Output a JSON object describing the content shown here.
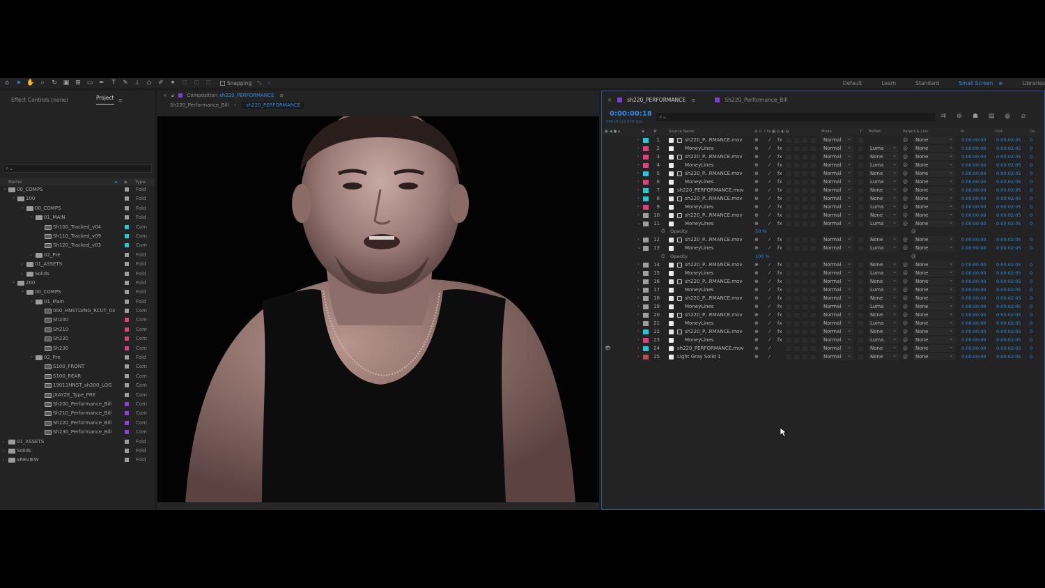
{
  "toolbar": {
    "snapping_label": "Snapping",
    "workspaces": [
      "Default",
      "Learn",
      "Standard",
      "Small Screen",
      "Libraries"
    ],
    "active_workspace": "Small Screen"
  },
  "project_panel": {
    "tabs": [
      "Effect Controls (none)",
      "Project"
    ],
    "search_placeholder": "⌕⌄",
    "columns": {
      "name": "Name",
      "type": "Type"
    },
    "items": [
      {
        "depth": 0,
        "kind": "folder",
        "open": true,
        "name": "00_COMPS",
        "label": "#9e9e9e",
        "type": "Fold"
      },
      {
        "depth": 1,
        "kind": "folder",
        "open": true,
        "name": "100",
        "label": "#9e9e9e",
        "type": "Fold"
      },
      {
        "depth": 2,
        "kind": "folder",
        "open": true,
        "name": "00_COMPS",
        "label": "#9e9e9e",
        "type": "Fold"
      },
      {
        "depth": 3,
        "kind": "folder",
        "open": true,
        "name": "01_MAIN",
        "label": "#9e9e9e",
        "type": "Fold"
      },
      {
        "depth": 4,
        "kind": "comp",
        "name": "Sh100_Tracked_v04",
        "label": "#1ec9d9",
        "type": "Com"
      },
      {
        "depth": 4,
        "kind": "comp",
        "name": "Sh110_Tracked_v09",
        "label": "#1ec9d9",
        "type": "Com"
      },
      {
        "depth": 4,
        "kind": "comp",
        "name": "Sh120_Tracked_v03",
        "label": "#1ec9d9",
        "type": "Com"
      },
      {
        "depth": 3,
        "kind": "folder",
        "open": false,
        "name": "02_Pre",
        "label": "#9e9e9e",
        "type": "Fold"
      },
      {
        "depth": 2,
        "kind": "folder",
        "open": false,
        "name": "01_ASSETS",
        "label": "#9e9e9e",
        "type": "Fold"
      },
      {
        "depth": 2,
        "kind": "folder",
        "open": false,
        "name": "Solids",
        "label": "#9e9e9e",
        "type": "Fold"
      },
      {
        "depth": 1,
        "kind": "folder",
        "open": true,
        "name": "200",
        "label": "#9e9e9e",
        "type": "Fold"
      },
      {
        "depth": 2,
        "kind": "folder",
        "open": true,
        "name": "00_COMPS",
        "label": "#9e9e9e",
        "type": "Fold"
      },
      {
        "depth": 3,
        "kind": "folder",
        "open": true,
        "name": "01_Main",
        "label": "#9e9e9e",
        "type": "Fold"
      },
      {
        "depth": 4,
        "kind": "comp",
        "name": "000_HNSTLVNG_RCUT_03",
        "label": "#9e9e9e",
        "type": "Com"
      },
      {
        "depth": 4,
        "kind": "comp",
        "name": "Sh200",
        "label": "#e0407e",
        "type": "Com"
      },
      {
        "depth": 4,
        "kind": "comp",
        "name": "Sh210",
        "label": "#e0407e",
        "type": "Com"
      },
      {
        "depth": 4,
        "kind": "comp",
        "name": "Sh220",
        "label": "#e0407e",
        "type": "Com"
      },
      {
        "depth": 4,
        "kind": "comp",
        "name": "Sh230",
        "label": "#e0407e",
        "type": "Com"
      },
      {
        "depth": 3,
        "kind": "folder",
        "open": true,
        "name": "02_Pre",
        "label": "#9e9e9e",
        "type": "Fold"
      },
      {
        "depth": 4,
        "kind": "comp",
        "name": "S100_FRONT",
        "label": "#9e9e9e",
        "type": "Com"
      },
      {
        "depth": 4,
        "kind": "comp",
        "name": "S100_REAR",
        "label": "#9e9e9e",
        "type": "Com"
      },
      {
        "depth": 4,
        "kind": "comp",
        "name": "19011HNST_sh200_LOG",
        "label": "#9e9e9e",
        "type": "Com"
      },
      {
        "depth": 4,
        "kind": "comp",
        "name": "JXAYZE_Type_PRE",
        "label": "#9e9e9e",
        "type": "Com"
      },
      {
        "depth": 4,
        "kind": "comp",
        "name": "Sh200_Performance_Bill",
        "label": "#8a3fe0",
        "type": "Com"
      },
      {
        "depth": 4,
        "kind": "comp",
        "name": "Sh210_Performance_Bill",
        "label": "#8a3fe0",
        "type": "Com"
      },
      {
        "depth": 4,
        "kind": "comp",
        "name": "Sh220_Performance_Bill",
        "label": "#8a3fe0",
        "type": "Com"
      },
      {
        "depth": 4,
        "kind": "comp",
        "name": "Sh230_Performance_Bill",
        "label": "#8a3fe0",
        "type": "Com"
      },
      {
        "depth": 0,
        "kind": "folder",
        "open": false,
        "name": "01_ASSETS",
        "label": "#9e9e9e",
        "type": "Fold"
      },
      {
        "depth": 0,
        "kind": "folder",
        "open": false,
        "name": "Solids",
        "label": "#9e9e9e",
        "type": "Fold"
      },
      {
        "depth": 0,
        "kind": "folder",
        "open": false,
        "name": "xREVIEW",
        "label": "#9e9e9e",
        "type": "Fold"
      }
    ]
  },
  "composition_panel": {
    "tab_prefix": "Composition",
    "tab_comp": "sh220_PERFORMANCE",
    "breadcrumb": [
      "Sh220_Performance_Bill",
      "sh220_PERFORMANCE"
    ]
  },
  "timeline": {
    "tabs": [
      "sh220_PERFORMANCE",
      "Sh220_Performance_Bill"
    ],
    "current_time": "0:00:00:18",
    "frame_readout": "00018 (23.976 fps)",
    "search_placeholder": "⌕⌄",
    "columns": {
      "num": "#",
      "source": "Source Name",
      "mode": "Mode",
      "t": "T",
      "trkmat": "TrkMat",
      "parent": "Parent & Link",
      "in": "In",
      "out": "Out",
      "dur": "Du"
    },
    "accent": "#2d8ceb",
    "rows": [
      {
        "kind": "layer",
        "num": "1",
        "label": "#1ec9d9",
        "icon": "mov",
        "name": "sh220_P...RMANCE.mov",
        "fx": true,
        "mode": "Normal",
        "trkmat": "",
        "parent": "None",
        "in": "0:00:00:00",
        "out": "0:00:02:05",
        "dur": "0"
      },
      {
        "kind": "layer",
        "num": "2",
        "label": "#e0407e",
        "icon": "solid",
        "name": "MoneyLines",
        "fx": true,
        "mode": "Normal",
        "trkmat": "Luma",
        "parent": "None",
        "in": "0:00:00:00",
        "out": "0:00:02:05",
        "dur": "0"
      },
      {
        "kind": "layer",
        "num": "3",
        "label": "#e0407e",
        "icon": "mov",
        "name": "sh220_P...RMANCE.mov",
        "fx": true,
        "mode": "Normal",
        "trkmat": "None",
        "parent": "None",
        "in": "0:00:00:00",
        "out": "0:00:02:05",
        "dur": "0"
      },
      {
        "kind": "layer",
        "num": "4",
        "label": "#e0407e",
        "icon": "solid",
        "name": "MoneyLines",
        "fx": true,
        "mode": "Normal",
        "trkmat": "Luma",
        "parent": "None",
        "in": "0:00:00:00",
        "out": "0:00:02:05",
        "dur": "0"
      },
      {
        "kind": "layer",
        "num": "5",
        "label": "#1ec9d9",
        "icon": "mov",
        "name": "sh220_P...RMANCE.mov",
        "fx": true,
        "mode": "Normal",
        "trkmat": "None",
        "parent": "None",
        "in": "0:00:00:00",
        "out": "0:00:02:05",
        "dur": "0"
      },
      {
        "kind": "layer",
        "num": "6",
        "label": "#e0407e",
        "icon": "solid",
        "name": "MoneyLines",
        "fx": true,
        "mode": "Normal",
        "trkmat": "Luma",
        "parent": "None",
        "in": "0:00:00:00",
        "out": "0:00:02:05",
        "dur": "0"
      },
      {
        "kind": "layer",
        "num": "7",
        "label": "#1ec9d9",
        "icon": "solid",
        "name": "sh220_PERFORMANCE.mov",
        "fx": true,
        "mode": "Normal",
        "trkmat": "None",
        "parent": "None",
        "in": "0:00:00:00",
        "out": "0:00:02:05",
        "dur": "0"
      },
      {
        "kind": "layer",
        "num": "8",
        "label": "#1ec9d9",
        "icon": "mov",
        "name": "sh220_P...RMANCE.mov",
        "fx": true,
        "mode": "Normal",
        "trkmat": "None",
        "parent": "None",
        "in": "0:00:00:00",
        "out": "0:00:02:05",
        "dur": "0"
      },
      {
        "kind": "layer",
        "num": "9",
        "label": "#e0407e",
        "icon": "solid",
        "name": "MoneyLines",
        "fx": true,
        "mode": "Normal",
        "trkmat": "Luma",
        "parent": "None",
        "in": "0:00:00:00",
        "out": "0:00:02:05",
        "dur": "0"
      },
      {
        "kind": "layer",
        "num": "10",
        "label": "#9e9e9e",
        "icon": "mov",
        "name": "sh220_P...RMANCE.mov",
        "fx": true,
        "mode": "Normal",
        "trkmat": "None",
        "parent": "None",
        "in": "0:00:00:00",
        "out": "0:00:02:05",
        "dur": "0"
      },
      {
        "kind": "layer",
        "num": "11",
        "label": "#9e9e9e",
        "icon": "solid",
        "open": true,
        "name": "MoneyLines",
        "fx": true,
        "mode": "Normal",
        "trkmat": "Luma",
        "parent": "None",
        "in": "0:00:00:00",
        "out": "0:00:02:05",
        "dur": "0"
      },
      {
        "kind": "prop",
        "name": "Opacity",
        "value": "50 %"
      },
      {
        "kind": "layer",
        "num": "12",
        "label": "#9e9e9e",
        "icon": "mov",
        "name": "sh220_P...RMANCE.mov",
        "fx": true,
        "mode": "Normal",
        "trkmat": "None",
        "parent": "None",
        "in": "0:00:00:00",
        "out": "0:00:02:05",
        "dur": "0"
      },
      {
        "kind": "layer",
        "num": "13",
        "label": "#9e9e9e",
        "icon": "solid",
        "open": true,
        "name": "MoneyLines",
        "fx": true,
        "mode": "Normal",
        "trkmat": "Luma",
        "parent": "None",
        "in": "0:00:00:00",
        "out": "0:00:02:05",
        "dur": "0"
      },
      {
        "kind": "prop",
        "name": "Opacity",
        "value": "100 %"
      },
      {
        "kind": "layer",
        "num": "14",
        "label": "#9e9e9e",
        "icon": "mov",
        "name": "sh220_P...RMANCE.mov",
        "fx": true,
        "mode": "Normal",
        "trkmat": "None",
        "parent": "None",
        "in": "0:00:00:00",
        "out": "0:00:02:05",
        "dur": "0"
      },
      {
        "kind": "layer",
        "num": "15",
        "label": "#9e9e9e",
        "icon": "solid",
        "name": "MoneyLines",
        "fx": true,
        "mode": "Normal",
        "trkmat": "Luma",
        "parent": "None",
        "in": "0:00:00:00",
        "out": "0:00:02:05",
        "dur": "0"
      },
      {
        "kind": "layer",
        "num": "16",
        "label": "#9e9e9e",
        "icon": "mov",
        "name": "sh220_P...RMANCE.mov",
        "fx": true,
        "mode": "Normal",
        "trkmat": "None",
        "parent": "None",
        "in": "0:00:00:00",
        "out": "0:00:02:05",
        "dur": "0"
      },
      {
        "kind": "layer",
        "num": "17",
        "label": "#9e9e9e",
        "icon": "solid",
        "name": "MoneyLines",
        "fx": true,
        "mode": "Normal",
        "trkmat": "Luma",
        "parent": "None",
        "in": "0:00:00:00",
        "out": "0:00:02:05",
        "dur": "0"
      },
      {
        "kind": "layer",
        "num": "18",
        "label": "#9e9e9e",
        "icon": "mov",
        "name": "sh220_P...RMANCE.mov",
        "fx": true,
        "mode": "Normal",
        "trkmat": "None",
        "parent": "None",
        "in": "0:00:00:00",
        "out": "0:00:02:05",
        "dur": "0"
      },
      {
        "kind": "layer",
        "num": "19",
        "label": "#9e9e9e",
        "icon": "solid",
        "name": "MoneyLines",
        "fx": true,
        "mode": "Normal",
        "trkmat": "Luma",
        "parent": "None",
        "in": "0:00:00:00",
        "out": "0:00:02:05",
        "dur": "0"
      },
      {
        "kind": "layer",
        "num": "20",
        "label": "#9e9e9e",
        "icon": "mov",
        "name": "sh220_P...RMANCE.mov",
        "fx": true,
        "mode": "Normal",
        "trkmat": "None",
        "parent": "None",
        "in": "0:00:00:00",
        "out": "0:00:02:05",
        "dur": "0"
      },
      {
        "kind": "layer",
        "num": "21",
        "label": "#9e9e9e",
        "icon": "solid",
        "name": "MoneyLines",
        "fx": true,
        "mode": "Normal",
        "trkmat": "Luma",
        "parent": "None",
        "in": "0:00:00:00",
        "out": "0:00:02:05",
        "dur": "0"
      },
      {
        "kind": "layer",
        "num": "22",
        "label": "#1ec9d9",
        "icon": "mov",
        "name": "sh220_P...RMANCE.mov",
        "fx": true,
        "mode": "Normal",
        "trkmat": "None",
        "parent": "None",
        "in": "0:00:00:00",
        "out": "0:00:02:05",
        "dur": "0"
      },
      {
        "kind": "layer",
        "num": "23",
        "label": "#e0407e",
        "icon": "solid",
        "name": "MoneyLines",
        "fx": true,
        "mode": "Normal",
        "trkmat": "Luma",
        "parent": "None",
        "in": "0:00:00:00",
        "out": "0:00:02:05",
        "dur": "0"
      },
      {
        "kind": "layer",
        "num": "24",
        "label": "#1ec9d9",
        "icon": "solid",
        "visible": true,
        "name": "sh220_PERFORMANCE.mov",
        "fx": false,
        "mode": "Normal",
        "trkmat": "None",
        "parent": "None",
        "in": "0:00:00:00",
        "out": "0:00:02:05",
        "dur": "0"
      },
      {
        "kind": "layer",
        "num": "25",
        "label": "#c44a4a",
        "icon": "solid",
        "name": "Light Gray Solid 1",
        "fx": false,
        "mode": "Normal",
        "trkmat": "None",
        "parent": "None",
        "in": "0:00:00:00",
        "out": "0:00:02:05",
        "dur": "0"
      }
    ]
  }
}
